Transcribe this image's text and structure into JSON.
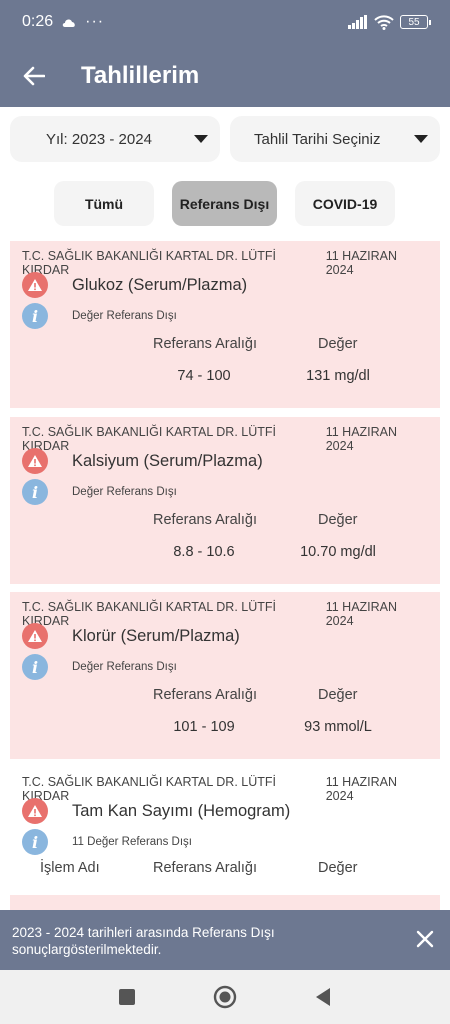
{
  "status": {
    "time": "0:26",
    "dots": "···",
    "battery": "55"
  },
  "header": {
    "title": "Tahlillerim"
  },
  "filters": {
    "year": "Yıl: 2023 - 2024",
    "date": "Tahlil Tarihi Seçiniz"
  },
  "tabs": [
    {
      "label": "Tümü",
      "selected": false
    },
    {
      "label": "Referans Dışı",
      "selected": true
    },
    {
      "label": "COVID-19",
      "selected": false
    }
  ],
  "cards": [
    {
      "hospital": "T.C. SAĞLIK BAKANLIĞI KARTAL DR. LÜTFİ KIRDAR",
      "date": "11 HAZIRAN 2024",
      "test": "Glukoz (Serum/Plazma)",
      "note": "Değer Referans Dışı",
      "ref_header": "Referans Aralığı",
      "val_header": "Değer",
      "ref": "74 - 100",
      "value": "131 mg/dl"
    },
    {
      "hospital": "T.C. SAĞLIK BAKANLIĞI KARTAL DR. LÜTFİ KIRDAR",
      "date": "11 HAZIRAN 2024",
      "test": "Kalsiyum (Serum/Plazma)",
      "note": "Değer Referans Dışı",
      "ref_header": "Referans Aralığı",
      "val_header": "Değer",
      "ref": "8.8 - 10.6",
      "value": "10.70 mg/dl"
    },
    {
      "hospital": "T.C. SAĞLIK BAKANLIĞI KARTAL DR. LÜTFİ KIRDAR",
      "date": "11 HAZIRAN 2024",
      "test": "Klorür (Serum/Plazma)",
      "note": "Değer Referans Dışı",
      "ref_header": "Referans Aralığı",
      "val_header": "Değer",
      "ref": "101 - 109",
      "value": "93 mmol/L"
    },
    {
      "hospital": "T.C. SAĞLIK BAKANLIĞI KARTAL DR. LÜTFİ KIRDAR",
      "date": "11 HAZIRAN 2024",
      "test": "Tam Kan Sayımı (Hemogram)",
      "note": "11 Değer Referans Dışı",
      "op_header": "İşlem Adı",
      "ref_header": "Referans Aralığı",
      "val_header": "Değer"
    }
  ],
  "snackbar": {
    "message": "2023 - 2024 tarihleri arasında Referans Dışı sonuçlargösterilmektedir."
  },
  "colors": {
    "primary": "#6d7891",
    "out_of_range_bg": "#fce4e4",
    "warning": "#e8716d",
    "info": "#8ab6de"
  },
  "icons": {
    "back": "arrow-left-icon",
    "warning": "warning-triangle-icon",
    "info": "info-icon",
    "close": "close-icon"
  }
}
